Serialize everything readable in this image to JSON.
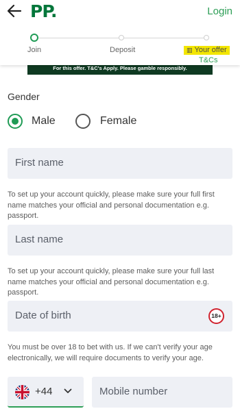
{
  "header": {
    "logo": "PP.",
    "login": "Login"
  },
  "steps": [
    {
      "label": "Join"
    },
    {
      "label": "Deposit"
    },
    {
      "label": "Your offer"
    }
  ],
  "tcs": "T&Cs",
  "banner": "For this offer. T&C's Apply. Please gamble responsibly.",
  "gender": {
    "label": "Gender",
    "options": [
      "Male",
      "Female"
    ],
    "selected": "Male"
  },
  "fields": {
    "first_name": {
      "placeholder": "First name",
      "help": "To set up your account quickly, please make sure your full first name matches your official and personal documentation e.g. passport."
    },
    "last_name": {
      "placeholder": "Last name",
      "help": "To set up your account quickly, please make sure your full last name matches your official and personal documentation e.g. passport."
    },
    "dob": {
      "placeholder": "Date of birth",
      "badge": "18+",
      "help": "You must be over 18 to bet with us. If we can't verify your age electronically, we will require documents to verify your age."
    }
  },
  "phone": {
    "code": "+44",
    "placeholder": "Mobile number"
  },
  "colors": {
    "brand": "#02763a",
    "accent": "#2d9e56",
    "highlight": "#f3e600",
    "field_bg": "#eef0f5"
  }
}
